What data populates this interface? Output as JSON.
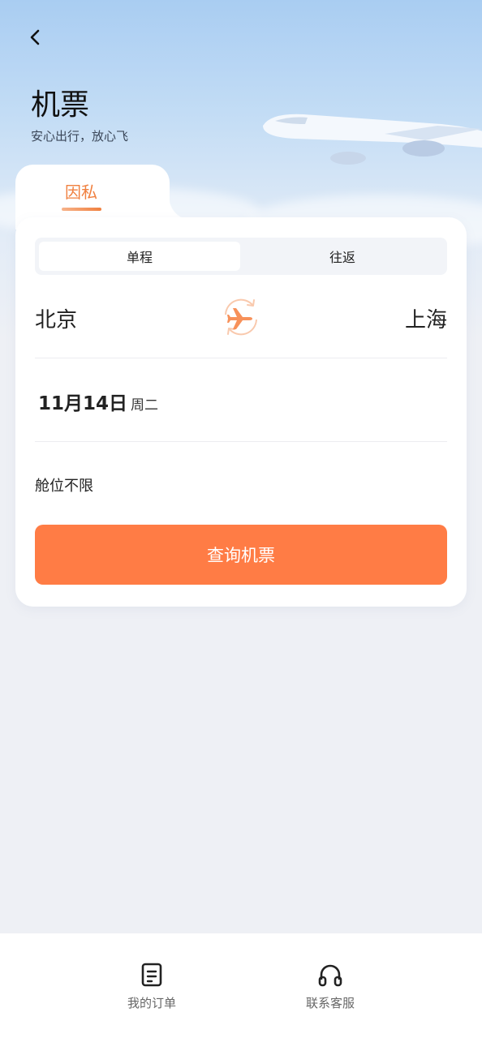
{
  "header": {
    "title": "机票",
    "subtitle": "安心出行，放心飞"
  },
  "tabs": {
    "active_label": "因私"
  },
  "trip_type": {
    "options": [
      "单程",
      "往返"
    ],
    "selected": "单程"
  },
  "route": {
    "from": "北京",
    "to": "上海"
  },
  "date": {
    "value": "11月14日",
    "weekday": "周二"
  },
  "cabin": {
    "label": "舱位不限"
  },
  "search_button": {
    "label": "查询机票"
  },
  "bottom_nav": [
    {
      "label": "我的订单",
      "icon": "order-icon"
    },
    {
      "label": "联系客服",
      "icon": "headset-icon"
    }
  ],
  "colors": {
    "accent": "#ff7c45",
    "tab_accent": "#f0803f"
  }
}
